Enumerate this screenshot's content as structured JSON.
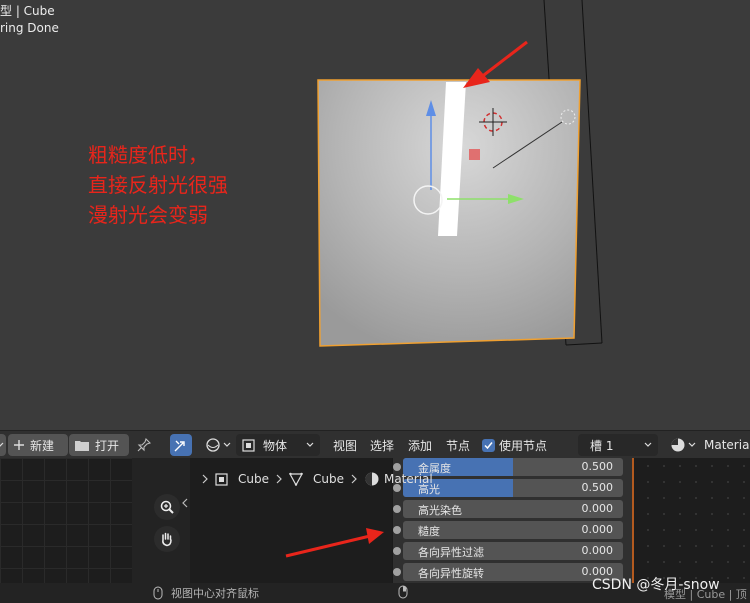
{
  "viewport": {
    "overlay_line1": "型 | Cube",
    "overlay_line2": "ring Done",
    "annotation": [
      "粗糙度低时，",
      "直接反射光很强",
      "漫射光会变弱"
    ]
  },
  "header": {
    "new_label": "新建",
    "open_label": "打开",
    "object_mode": "物体",
    "menu_view": "视图",
    "menu_select": "选择",
    "menu_add": "添加",
    "menu_node": "节点",
    "use_nodes_label": "使用节点",
    "use_nodes_checked": true,
    "slot_label": "槽 1",
    "material_label": "Material"
  },
  "breadcrumb": {
    "object": "Cube",
    "mesh": "Cube",
    "material": "Material"
  },
  "properties": [
    {
      "label": "金属度",
      "value": "0.500",
      "fill": 0.5
    },
    {
      "label": "高光",
      "value": "0.500",
      "fill": 0.5
    },
    {
      "label": "高光染色",
      "value": "0.000",
      "fill": 0.0
    },
    {
      "label": "糙度",
      "value": "0.000",
      "fill": 0.0
    },
    {
      "label": "各向异性过滤",
      "value": "0.000",
      "fill": 0.0
    },
    {
      "label": "各向异性旋转",
      "value": "0.000",
      "fill": 0.0
    }
  ],
  "status": {
    "left_text": "视图中心对齐鼠标",
    "right_text": "模型 | Cube | 顶"
  },
  "watermark": "CSDN @冬月-snow",
  "colors": {
    "accent": "#4772b3",
    "annotation": "#e8251b",
    "selection_outline": "#f0a030"
  }
}
